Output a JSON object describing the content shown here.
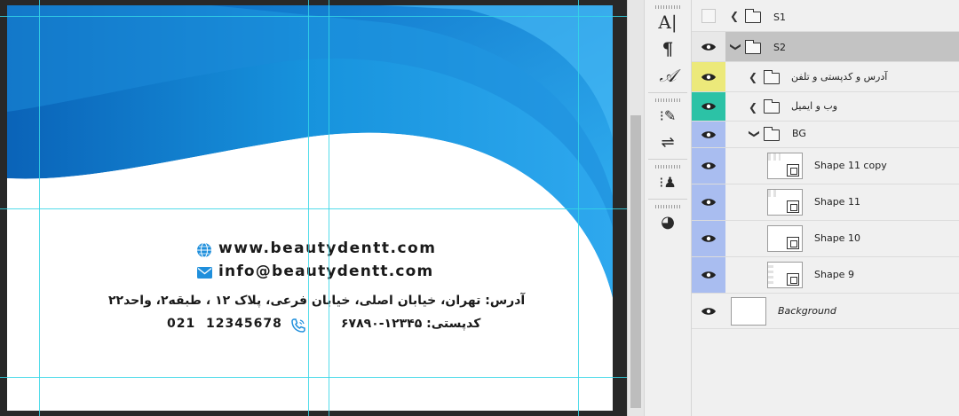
{
  "document": {
    "website": "www.beautydentt.com",
    "email": "info@beautydentt.com",
    "address": "آدرس: تهران، خیابان اصلی، خیابان فرعی، پلاک ۱۲ ، طبقه۲، واحد۲۲",
    "postal_code": "کدپستی: ۱۲۳۴۵-۶۷۸۹۰",
    "phone": "021  12345678",
    "icons": {
      "web": "globe-icon",
      "mail": "mail-icon",
      "phone": "phone-icon"
    },
    "colors": {
      "blue_dark": "#0a63b8",
      "blue_light": "#2ea8ee",
      "guide": "#35d6e6"
    }
  },
  "tools": [
    {
      "name": "character-tool",
      "glyph": "A|"
    },
    {
      "name": "paragraph-tool",
      "glyph": "¶"
    },
    {
      "name": "glyphs-tool",
      "glyph": "𝒜"
    },
    {
      "name": "brush-presets-tool",
      "glyph": "⁝✎"
    },
    {
      "name": "adjustments-tool",
      "glyph": "⇌"
    },
    {
      "name": "clone-source-tool",
      "glyph": "⁝♟"
    },
    {
      "name": "3d-tool",
      "glyph": "◕"
    }
  ],
  "layers": [
    {
      "name": "S1",
      "type": "group",
      "visible": false,
      "expanded": false,
      "indent": 0,
      "color": ""
    },
    {
      "name": "S2",
      "type": "group",
      "visible": true,
      "expanded": true,
      "indent": 0,
      "color": "",
      "selected": true
    },
    {
      "name": "آدرس و کدپستی و تلفن",
      "type": "group",
      "visible": true,
      "expanded": false,
      "indent": 1,
      "color": "#ece97a"
    },
    {
      "name": "وب و ایمیل",
      "type": "group",
      "visible": true,
      "expanded": false,
      "indent": 1,
      "color": "#2cc2a6"
    },
    {
      "name": "BG",
      "type": "group",
      "visible": true,
      "expanded": true,
      "indent": 1,
      "color": "#a9bdf0"
    },
    {
      "name": "Shape 11 copy",
      "type": "shape",
      "visible": true,
      "indent": 2,
      "color": "#a9bdf0"
    },
    {
      "name": "Shape 11",
      "type": "shape",
      "visible": true,
      "indent": 2,
      "color": "#a9bdf0"
    },
    {
      "name": "Shape 10",
      "type": "shape",
      "visible": true,
      "indent": 2,
      "color": "#a9bdf0"
    },
    {
      "name": "Shape 9",
      "type": "shape",
      "visible": true,
      "indent": 2,
      "color": "#a9bdf0"
    },
    {
      "name": "Background",
      "type": "background",
      "visible": true,
      "indent": 0,
      "color": ""
    }
  ]
}
